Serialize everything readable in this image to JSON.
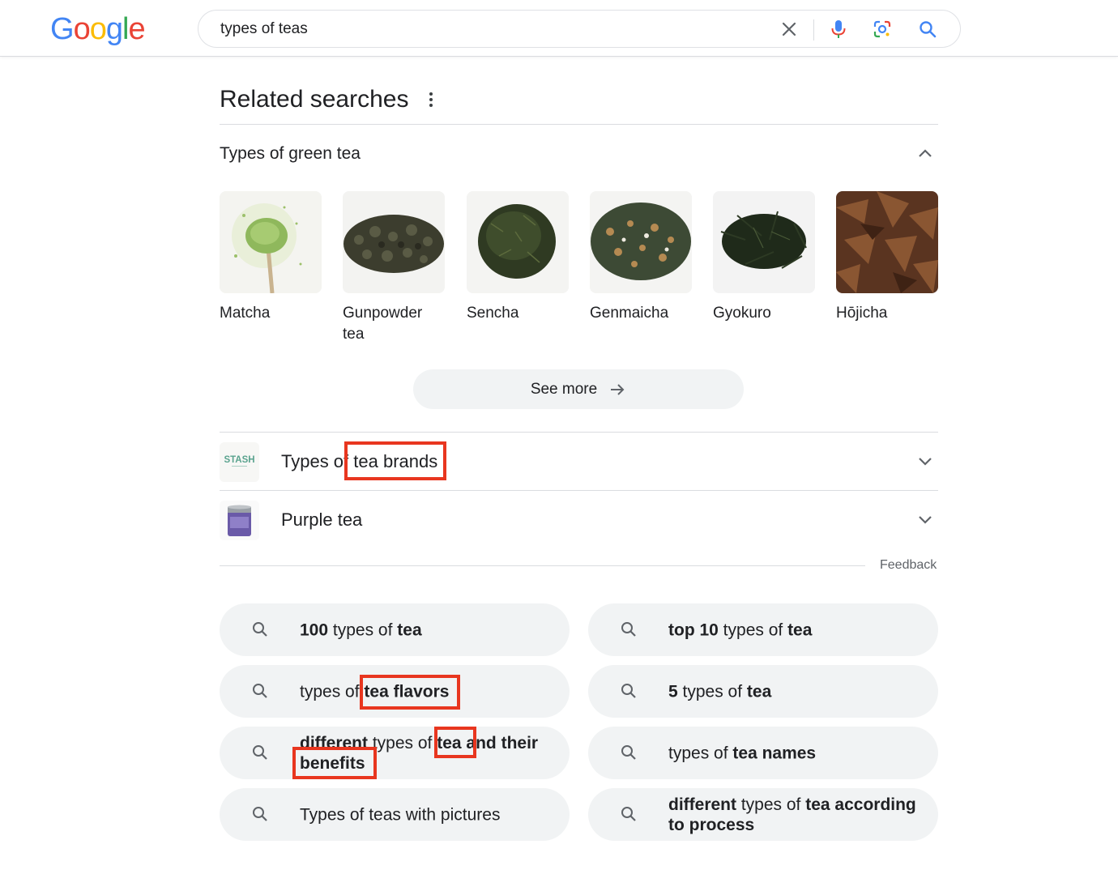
{
  "header": {
    "logo_letters": [
      {
        "ch": "G",
        "color": "#4285F4"
      },
      {
        "ch": "o",
        "color": "#EA4335"
      },
      {
        "ch": "o",
        "color": "#FBBC05"
      },
      {
        "ch": "g",
        "color": "#4285F4"
      },
      {
        "ch": "l",
        "color": "#34A853"
      },
      {
        "ch": "e",
        "color": "#EA4335"
      }
    ],
    "query": "types of teas",
    "icons": [
      "close-icon",
      "microphone-icon",
      "lens-icon",
      "search-icon"
    ]
  },
  "related": {
    "title": "Related searches",
    "group_title": "Types of green tea",
    "teas": [
      {
        "label": "Matcha",
        "line2": ""
      },
      {
        "label": "Gunpowder",
        "line2": "tea"
      },
      {
        "label": "Sencha",
        "line2": ""
      },
      {
        "label": "Genmaicha",
        "line2": ""
      },
      {
        "label": "Gyokuro",
        "line2": ""
      },
      {
        "label": "Hōjicha",
        "line2": ""
      }
    ],
    "see_more": "See more",
    "rows": [
      {
        "label": "Types of tea brands",
        "thumb_text": "STASH"
      },
      {
        "label": "Purple tea",
        "thumb_text": ""
      }
    ],
    "feedback": "Feedback"
  },
  "suggestions": [
    {
      "parts": [
        [
          "100",
          true
        ],
        [
          " types of ",
          false
        ],
        [
          "tea",
          true
        ]
      ]
    },
    {
      "parts": [
        [
          "top 10",
          true
        ],
        [
          " types of ",
          false
        ],
        [
          "tea",
          true
        ]
      ]
    },
    {
      "parts": [
        [
          "types of ",
          false
        ],
        [
          "tea flavors",
          true
        ]
      ]
    },
    {
      "parts": [
        [
          "5",
          true
        ],
        [
          " types of ",
          false
        ],
        [
          "tea",
          true
        ]
      ]
    },
    {
      "parts": [
        [
          "different",
          true
        ],
        [
          " types of ",
          false
        ],
        [
          "tea",
          true
        ],
        [
          " and their benefits",
          true
        ]
      ]
    },
    {
      "parts": [
        [
          "types of ",
          false
        ],
        [
          "tea names",
          true
        ]
      ]
    },
    {
      "parts": [
        [
          "Types of teas with pictures",
          false
        ]
      ]
    },
    {
      "parts": [
        [
          "different",
          true
        ],
        [
          " types of ",
          false
        ],
        [
          "tea according to process",
          true
        ]
      ]
    }
  ],
  "colors": {
    "highlight_box": "#e8361f",
    "pill_bg": "#f1f3f4"
  }
}
